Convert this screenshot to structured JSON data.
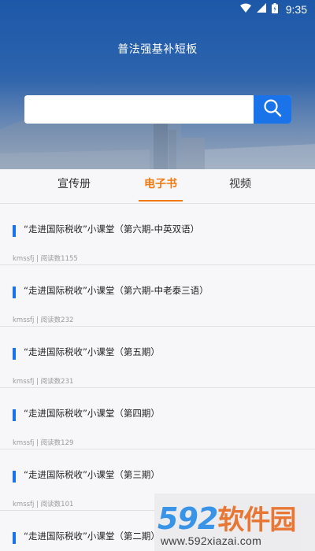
{
  "status_bar": {
    "time": "9:35"
  },
  "header": {
    "title": "普法强基补短板",
    "search": {
      "placeholder": ""
    }
  },
  "tabs": [
    {
      "label": "宣传册",
      "active": false
    },
    {
      "label": "电子书",
      "active": true
    },
    {
      "label": "视频",
      "active": false
    }
  ],
  "items": [
    {
      "title": "“走进国际税收”小课堂（第六期-中英双语）",
      "meta": "kmssfj | 阅读数1155"
    },
    {
      "title": "“走进国际税收”小课堂（第六期-中老泰三语）",
      "meta": "kmssfj | 阅读数232"
    },
    {
      "title": "“走进国际税收”小课堂（第五期）",
      "meta": "kmssfj | 阅读数231"
    },
    {
      "title": "“走进国际税收”小课堂（第四期）",
      "meta": "kmssfj | 阅读数129"
    },
    {
      "title": "“走进国际税收”小课堂（第三期）",
      "meta": "kmssfj | 阅读数101"
    },
    {
      "title": "“走进国际税收”小课堂（第二期）",
      "meta": ""
    }
  ],
  "watermark": {
    "logo_num": "592",
    "logo_text": "软件园",
    "url": "www.592xiazai.com"
  },
  "colors": {
    "accent": "#1a73e8",
    "active_tab": "#f07a10",
    "header_blue": "#1d58a8"
  }
}
